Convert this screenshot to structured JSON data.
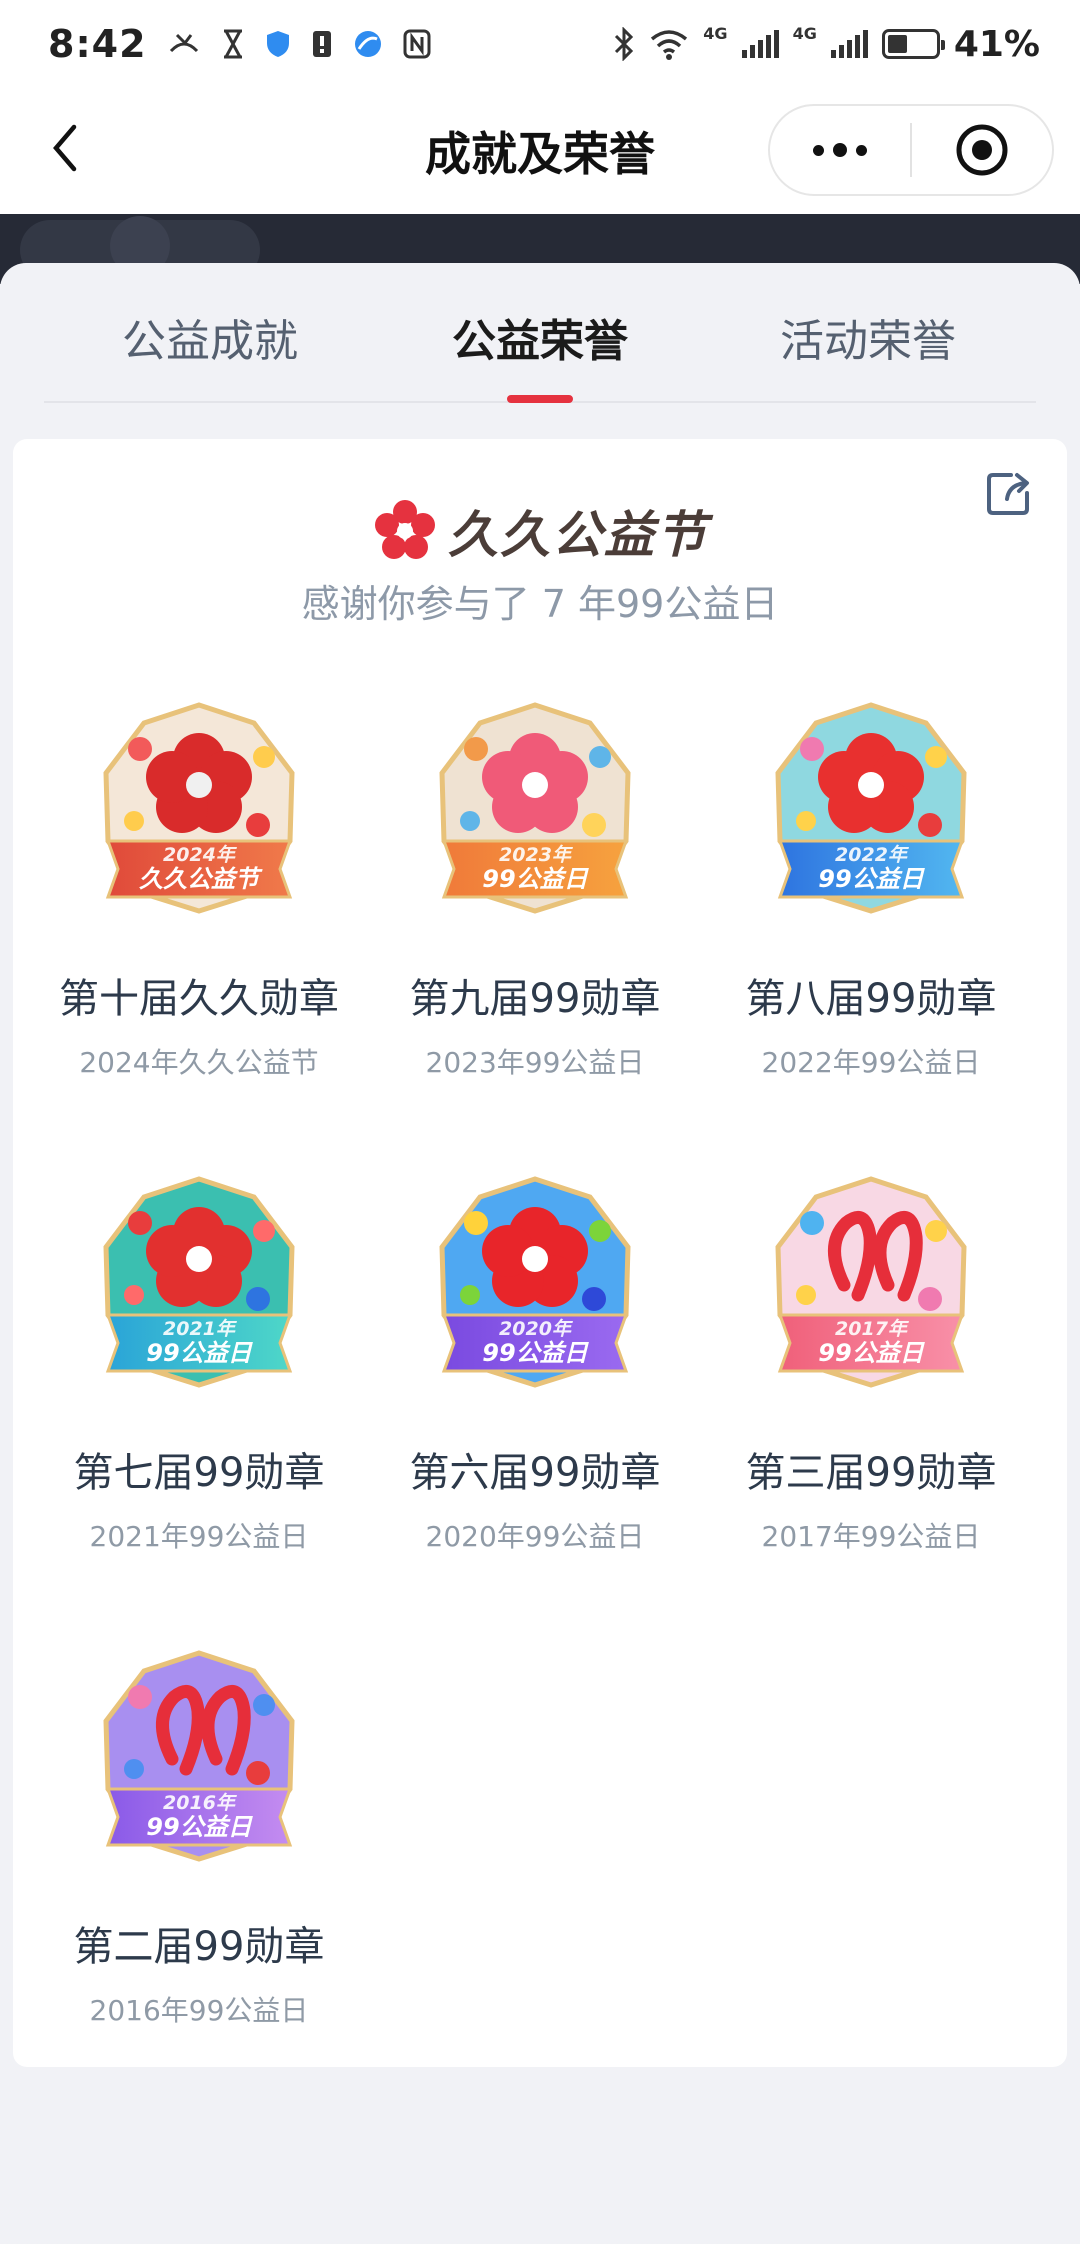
{
  "status_bar": {
    "time": "8:42",
    "net_4g_a": "4G",
    "net_4g_b": "4G",
    "battery_pct": "41%",
    "battery_level": 0.41
  },
  "nav": {
    "title": "成就及荣誉",
    "back_icon": "chevron-left-icon",
    "more_icon": "more-dots-icon",
    "close_icon": "target-circle-icon"
  },
  "tabs": [
    {
      "label": "公益成就",
      "active": false
    },
    {
      "label": "公益荣誉",
      "active": true
    },
    {
      "label": "活动荣誉",
      "active": false
    }
  ],
  "card": {
    "brand": "久久公益节",
    "subtitle": "感谢你参与了 7 年99公益日",
    "share_icon": "share-icon"
  },
  "medals": [
    {
      "name": "第十届久久勋章",
      "date": "2024年久久公益节",
      "badge_year": "2024年",
      "badge_text": "久久公益节",
      "theme": "red"
    },
    {
      "name": "第九届99勋章",
      "date": "2023年99公益日",
      "badge_year": "2023年",
      "badge_text": "99公益日",
      "theme": "orange"
    },
    {
      "name": "第八届99勋章",
      "date": "2022年99公益日",
      "badge_year": "2022年",
      "badge_text": "99公益日",
      "theme": "blue"
    },
    {
      "name": "第七届99勋章",
      "date": "2021年99公益日",
      "badge_year": "2021年",
      "badge_text": "99公益日",
      "theme": "teal"
    },
    {
      "name": "第六届99勋章",
      "date": "2020年99公益日",
      "badge_year": "2020年",
      "badge_text": "99公益日",
      "theme": "rainbow"
    },
    {
      "name": "第三届99勋章",
      "date": "2017年99公益日",
      "badge_year": "2017年",
      "badge_text": "99公益日",
      "theme": "pink"
    },
    {
      "name": "第二届99勋章",
      "date": "2016年99公益日",
      "badge_year": "2016年",
      "badge_text": "99公益日",
      "theme": "purple"
    }
  ],
  "colors": {
    "accent": "#e5323f",
    "background": "#f1f2f6",
    "card": "#ffffff",
    "dark_band": "#262a36"
  }
}
